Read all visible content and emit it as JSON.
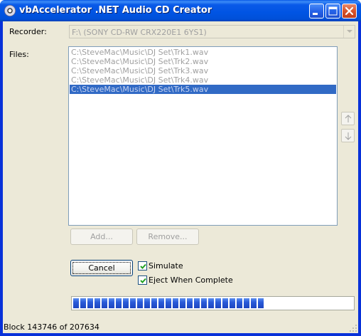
{
  "window": {
    "title": "vbAccelerator .NET Audio CD Creator",
    "controls": {
      "minimize": "minimize-icon",
      "maximize": "maximize-icon",
      "close": "close-icon"
    }
  },
  "recorder": {
    "label": "Recorder:",
    "value": "F:\\ (SONY CD-RW CRX220E1 6YS1)"
  },
  "files": {
    "label": "Files:",
    "items": [
      {
        "path": "C:\\SteveMac\\Music\\DJ Set\\Trk1.wav",
        "selected": false
      },
      {
        "path": "C:\\SteveMac\\Music\\DJ Set\\Trk2.wav",
        "selected": false
      },
      {
        "path": "C:\\SteveMac\\Music\\DJ Set\\Trk3.wav",
        "selected": false
      },
      {
        "path": "C:\\SteveMac\\Music\\DJ Set\\Trk4.wav",
        "selected": false
      },
      {
        "path": "C:\\SteveMac\\Music\\DJ Set\\Trk5.wav",
        "selected": true
      }
    ],
    "move_up_icon": "arrow-up-icon",
    "move_down_icon": "arrow-down-icon"
  },
  "buttons": {
    "add": "Add...",
    "remove": "Remove...",
    "cancel": "Cancel"
  },
  "options": {
    "simulate": {
      "label": "Simulate",
      "checked": true
    },
    "eject": {
      "label": "Eject When Complete",
      "checked": true
    }
  },
  "progress": {
    "current": 143746,
    "total": 207634,
    "fraction": 0.692
  },
  "status": {
    "text": "Block 143746 of 207634"
  },
  "colors": {
    "accent": "#316ac5",
    "titlebar": "#0054e3",
    "progress": "#2a5ad8",
    "face": "#ece9d8"
  }
}
